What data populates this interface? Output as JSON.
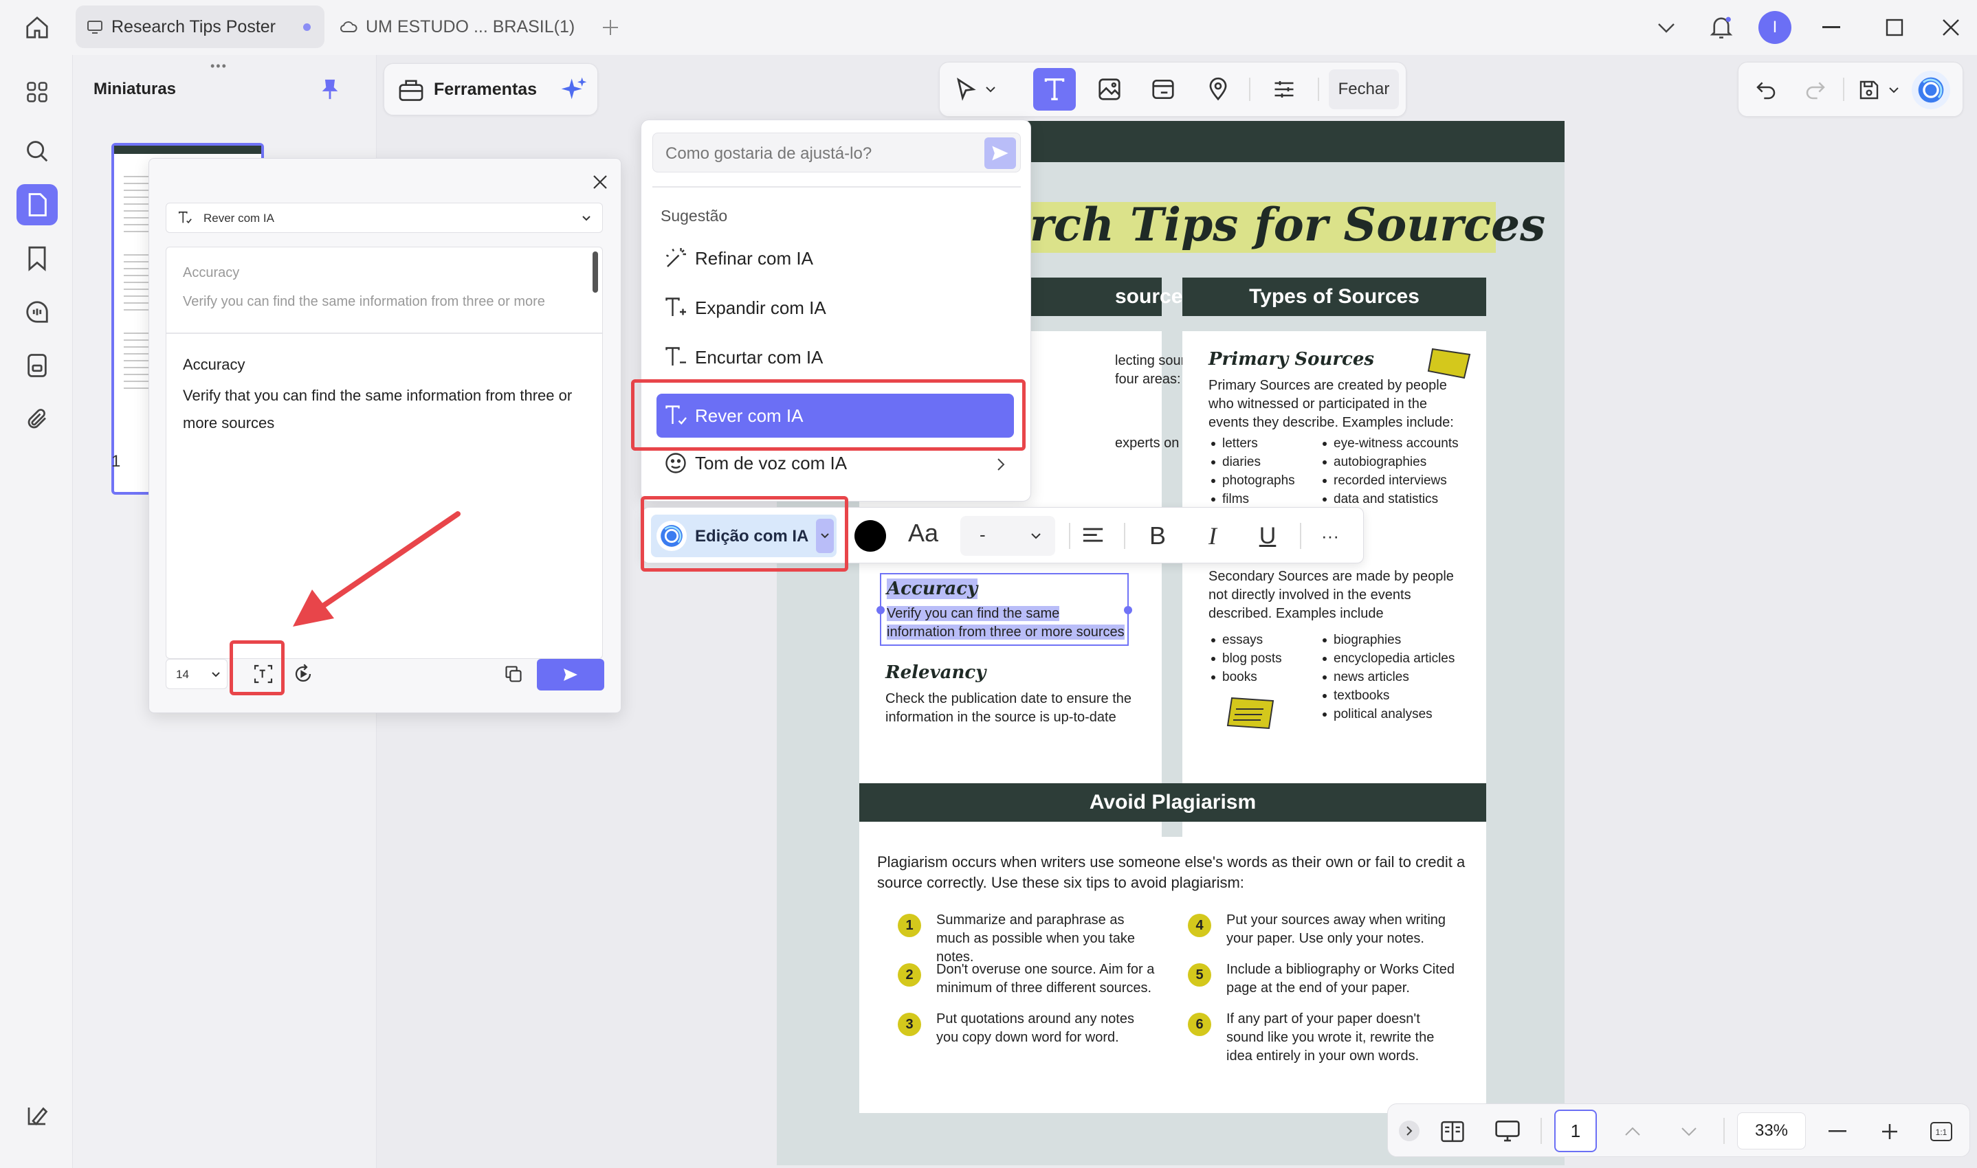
{
  "tabs": [
    {
      "label": "Research Tips Poster"
    },
    {
      "label": "UM ESTUDO ... BRASIL(1)"
    }
  ],
  "window": {
    "user_initial": "I"
  },
  "thumbnails": {
    "title": "Miniaturas",
    "page_number": "1"
  },
  "tools": {
    "label": "Ferramentas"
  },
  "edit_toolbar": {
    "close_label": "Fechar"
  },
  "dialog": {
    "mode_select": "Rever com IA",
    "original_title": "Accuracy",
    "original_text": "Verify you can find the same information from three or more",
    "result_title": "Accuracy",
    "result_text": "Verify that you can find the same information from three or more sources",
    "font_size": "14"
  },
  "ai_menu": {
    "placeholder": "Como gostaria de ajustá-lo?",
    "section_label": "Sugestão",
    "items": [
      {
        "label": "Refinar com IA"
      },
      {
        "label": "Expandir com IA"
      },
      {
        "label": "Encurtar com IA"
      },
      {
        "label": "Rever com IA"
      },
      {
        "label": "Tom de voz com IA"
      }
    ]
  },
  "format_toolbar": {
    "ai_edit_label": "Edição com IA",
    "font_label": "Aa",
    "font_size": "-",
    "bold": "B",
    "italic": "I",
    "underline": "U",
    "more": "···"
  },
  "poster": {
    "title_fragment": "rch Tips for Sources",
    "left_header_fragment": "sources",
    "left_text_1": "lecting sources,",
    "left_text_2": "four areas:",
    "left_text_3": "experts on your",
    "types_header": "Types of Sources",
    "primary_title": "Primary Sources",
    "primary_text": "Primary Sources are created by people who witnessed or participated in the events they describe. Examples include:",
    "primary_list_a": [
      "letters",
      "diaries",
      "photographs",
      "films"
    ],
    "primary_list_b": [
      "eye-witness accounts",
      "autobiographies",
      "recorded interviews",
      "data and statistics"
    ],
    "secondary_text": "Secondary Sources are made by people not directly involved in the events described. Examples include",
    "secondary_list_a": [
      "essays",
      "blog posts",
      "books"
    ],
    "secondary_list_b": [
      "biographies",
      "encyclopedia articles",
      "news articles",
      "textbooks",
      "political analyses"
    ],
    "accuracy_title": "Accuracy",
    "accuracy_text": "Verify you can find the same information from three or more sources",
    "relevancy_title": "Relevancy",
    "relevancy_text": "Check the publication date to ensure the information in the source is up-to-date",
    "plagiarism_header": "Avoid Plagiarism",
    "plagiarism_intro": "Plagiarism occurs when writers use someone else's words as their own or fail to credit a source correctly. Use these six tips to avoid plagiarism:",
    "tips": [
      {
        "n": "1",
        "text": "Summarize and paraphrase as much as possible when you take notes."
      },
      {
        "n": "2",
        "text": "Don't overuse one source. Aim for a minimum of three different sources."
      },
      {
        "n": "3",
        "text": "Put quotations around any notes you copy down word for word."
      },
      {
        "n": "4",
        "text": "Put your sources away when writing your paper. Use only your notes."
      },
      {
        "n": "5",
        "text": "Include a bibliography or Works Cited page at the end of your paper."
      },
      {
        "n": "6",
        "text": "If any part of your paper doesn't sound like you wrote it, rewrite the idea entirely in your own words."
      }
    ]
  },
  "bottom_bar": {
    "page": "1",
    "zoom": "33%"
  },
  "colors": {
    "accent": "#6b6ff5",
    "red_highlight": "#e8454a",
    "poster_dark": "#2d3d38",
    "poster_yellow": "#d4c81c"
  }
}
